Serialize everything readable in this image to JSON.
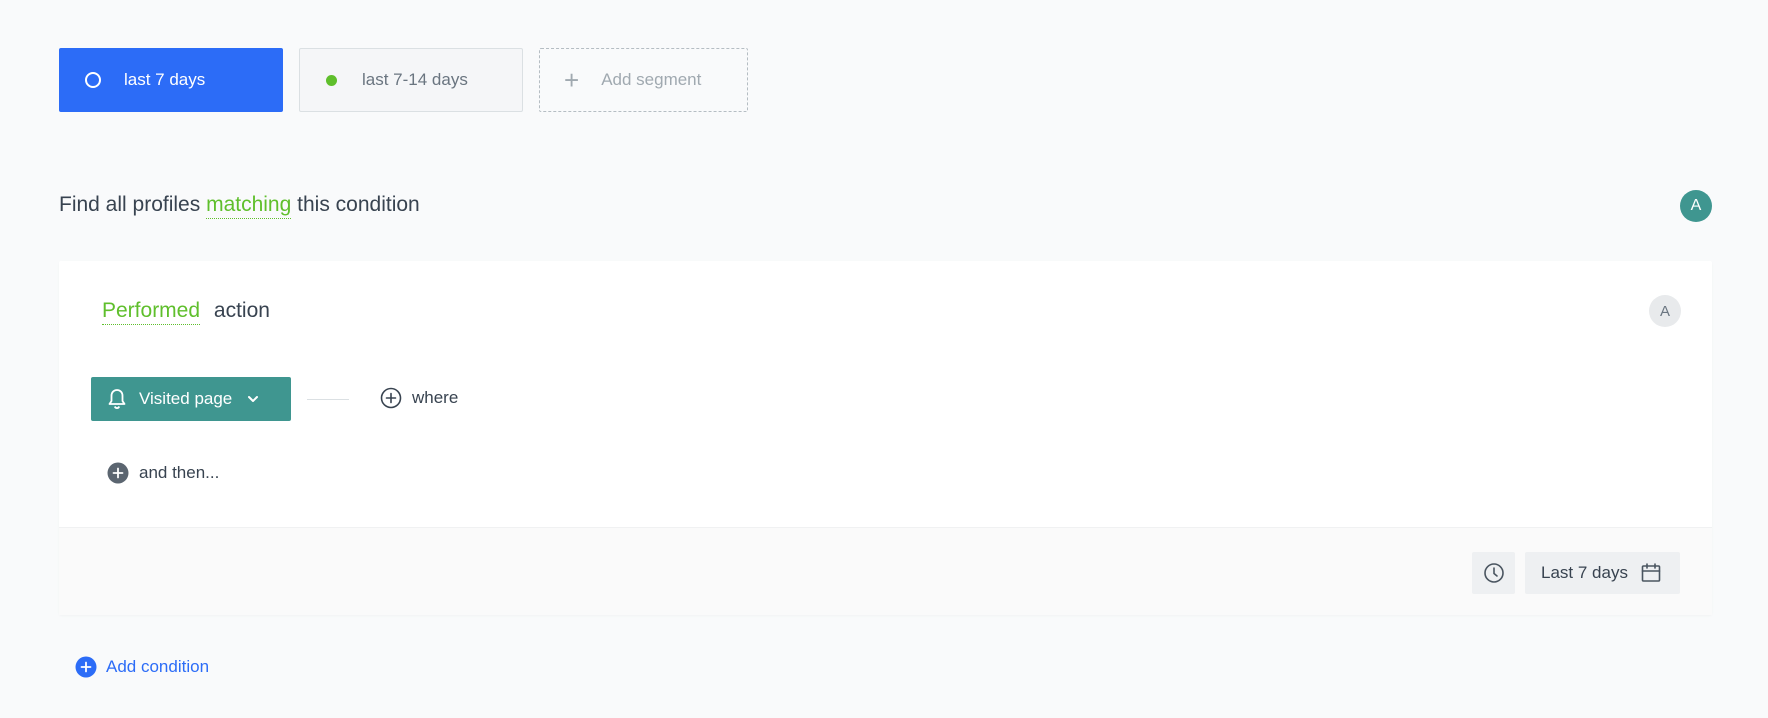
{
  "segments": [
    {
      "label": "last 7 days",
      "state": "active",
      "icon": "ring-icon"
    },
    {
      "label": "last 7-14 days",
      "state": "idle",
      "icon": "green-dot-icon"
    },
    {
      "label": "Add segment",
      "state": "add",
      "icon": "plus-icon"
    }
  ],
  "heading": {
    "prefix": "Find all profiles",
    "match_mode": "matching",
    "suffix": "this condition",
    "avatar": "A"
  },
  "condition": {
    "mode": "Performed",
    "subject": "action",
    "avatar": "A",
    "event_label": "Visited page",
    "where_label": "where",
    "and_then_label": "and then...",
    "date_range_label": "Last 7 days"
  },
  "add_condition_label": "Add condition",
  "colors": {
    "primary": "#2c6cf7",
    "teal": "#3f9690",
    "green": "#5fbf2c",
    "text": "#384350"
  }
}
